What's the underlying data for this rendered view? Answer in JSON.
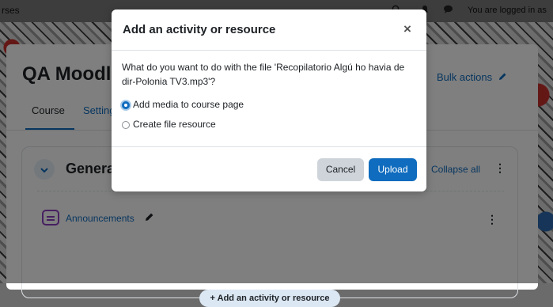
{
  "navbar": {
    "brand_text": "rses",
    "login_text": "You are logged in as",
    "icons": [
      "search-icon",
      "bell-icon",
      "chat-icon"
    ]
  },
  "page": {
    "course_title": "QA Moodle",
    "bulk_actions_label": "Bulk actions",
    "tabs": [
      {
        "label": "Course"
      },
      {
        "label": "Setting"
      }
    ],
    "section_title": "Genera",
    "collapse_all_label": "Collapse all",
    "activity": {
      "label": "Announcements",
      "icon": "forum-icon"
    },
    "add_activity_label": "+ Add an activity or resource"
  },
  "modal": {
    "title": "Add an activity or resource",
    "close_glyph": "×",
    "question": "What do you want to do with the file 'Recopilatorio Algú ho havia de dir-Polonia TV3.mp3'?",
    "options": [
      {
        "label": "Add media to course page",
        "checked": true
      },
      {
        "label": "Create file resource",
        "checked": false
      }
    ],
    "cancel_label": "Cancel",
    "upload_label": "Upload"
  },
  "colors": {
    "primary": "#0f6cbf",
    "secondary_button": "#ced4da",
    "forum_icon": "#8c3fc2"
  }
}
